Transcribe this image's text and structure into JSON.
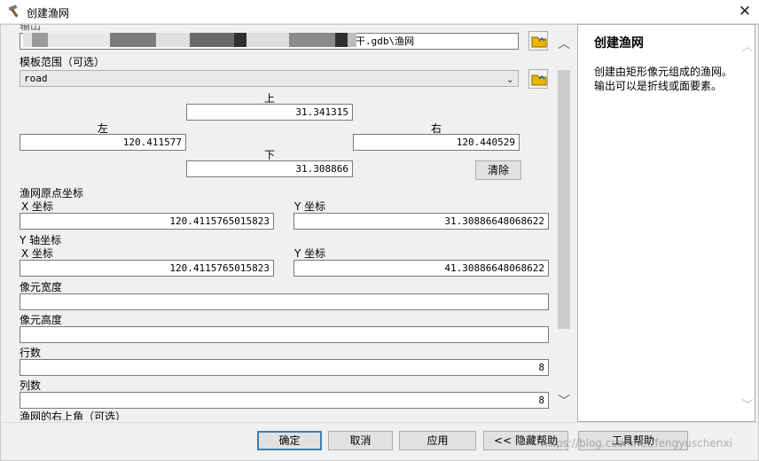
{
  "window": {
    "title": "创建渔网"
  },
  "form": {
    "output_label": "输出",
    "output_value": "干.gdb\\渔网",
    "template_label": "模板范围（可选）",
    "template_value": "road",
    "extent": {
      "top_label": "上",
      "top_value": "31.341315",
      "left_label": "左",
      "left_value": "120.411577",
      "right_label": "右",
      "right_value": "120.440529",
      "bottom_label": "下",
      "bottom_value": "31.308866",
      "clear_label": "清除"
    },
    "origin": {
      "label": "渔网原点坐标",
      "x_label": "X 坐标",
      "x_value": "120.4115765015823",
      "y_label": "Y 坐标",
      "y_value": "31.30886648068622"
    },
    "yaxis": {
      "label": "Y 轴坐标",
      "x_label": "X 坐标",
      "x_value": "120.4115765015823",
      "y_label": "Y 坐标",
      "y_value": "41.30886648068622"
    },
    "cell_width": {
      "label": "像元宽度",
      "value": ""
    },
    "cell_height": {
      "label": "像元高度",
      "value": ""
    },
    "rows": {
      "label": "行数",
      "value": "8"
    },
    "cols": {
      "label": "列数",
      "value": "8"
    },
    "corner_label": "渔网的右上角（可选）"
  },
  "help": {
    "title": "创建渔网",
    "body": "创建由矩形像元组成的渔网。输出可以是折线或面要素。"
  },
  "buttons": {
    "ok": "确定",
    "cancel": "取消",
    "apply": "应用",
    "hide_help": "<< 隐藏帮助",
    "tool_help": "工具帮助"
  },
  "watermark": "https://blog.csdn.net/fengyuschenxi",
  "colors": {
    "accent": "#3c7fb1",
    "folder": "#e8b400"
  }
}
